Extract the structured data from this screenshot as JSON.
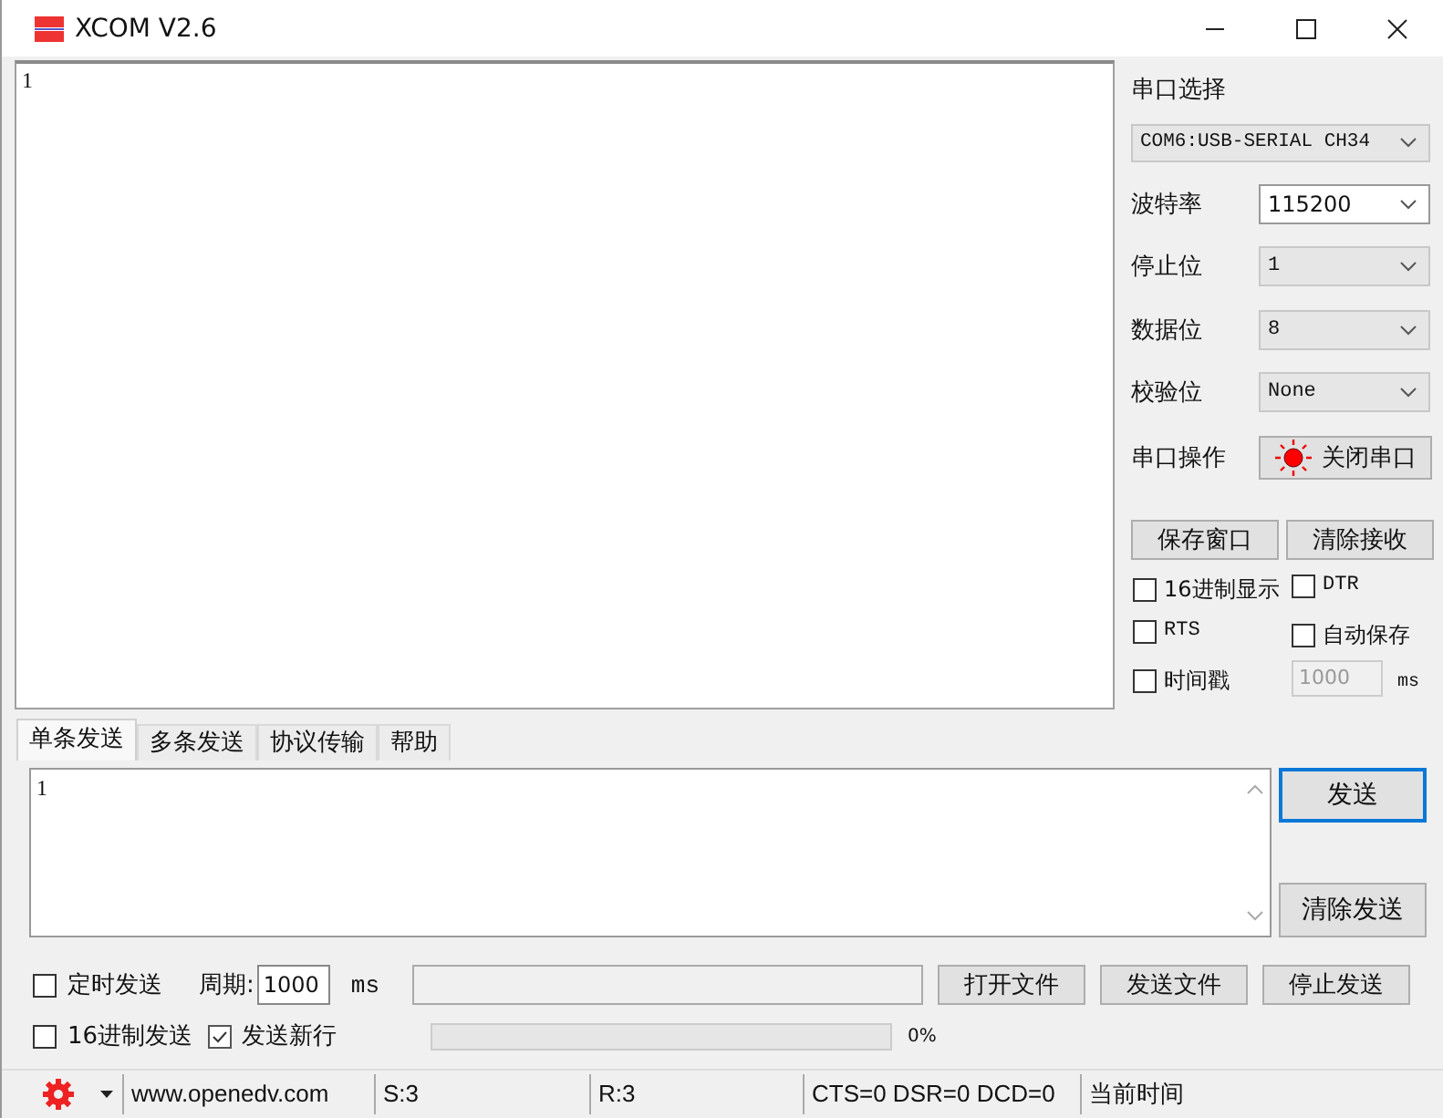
{
  "window": {
    "title": "XCOM V2.6"
  },
  "receive_area": {
    "text": "1"
  },
  "port_panel": {
    "port_label": "串口选择",
    "port_value": "COM6:USB-SERIAL CH34",
    "settings": [
      {
        "label": "波特率",
        "value": "115200",
        "kind": "editable"
      },
      {
        "label": "停止位",
        "value": "1",
        "kind": "dropdown"
      },
      {
        "label": "数据位",
        "value": "8",
        "kind": "dropdown"
      },
      {
        "label": "校验位",
        "value": "None",
        "kind": "dropdown"
      }
    ],
    "operation_label": "串口操作",
    "operation_button": "关闭串口",
    "port_open": true,
    "buttons": [
      "保存窗口",
      "清除接收"
    ],
    "options": [
      {
        "label": "16进制显示",
        "checked": false
      },
      {
        "label": "DTR",
        "checked": false
      },
      {
        "label": "RTS",
        "checked": false
      },
      {
        "label": "自动保存",
        "checked": false
      },
      {
        "label": "时间戳",
        "checked": false
      }
    ],
    "timestamp_interval": "1000",
    "timestamp_unit": "ms"
  },
  "tabs": [
    {
      "label": "单条发送",
      "selected": true
    },
    {
      "label": "多条发送",
      "selected": false
    },
    {
      "label": "协议传输",
      "selected": false
    },
    {
      "label": "帮助",
      "selected": false
    }
  ],
  "send_area": {
    "text": "1"
  },
  "send_buttons": [
    {
      "label": "发送",
      "focused": true
    },
    {
      "label": "清除发送",
      "focused": false
    }
  ],
  "timed_send": {
    "label": "定时发送",
    "checked": false
  },
  "period": {
    "label": "周期:",
    "value": "1000",
    "unit": "ms"
  },
  "file_buttons": [
    "打开文件",
    "发送文件",
    "停止发送"
  ],
  "hex_send": {
    "label": "16进制发送",
    "checked": false
  },
  "newline": {
    "label": "发送新行",
    "checked": true
  },
  "progress": {
    "level": 0,
    "reading": "0%"
  },
  "status_bar": {
    "website": "www.openedv.com",
    "sent": "S:3",
    "received": "R:3",
    "signals": "CTS=0 DSR=0 DCD=0",
    "time": "当前时间"
  }
}
